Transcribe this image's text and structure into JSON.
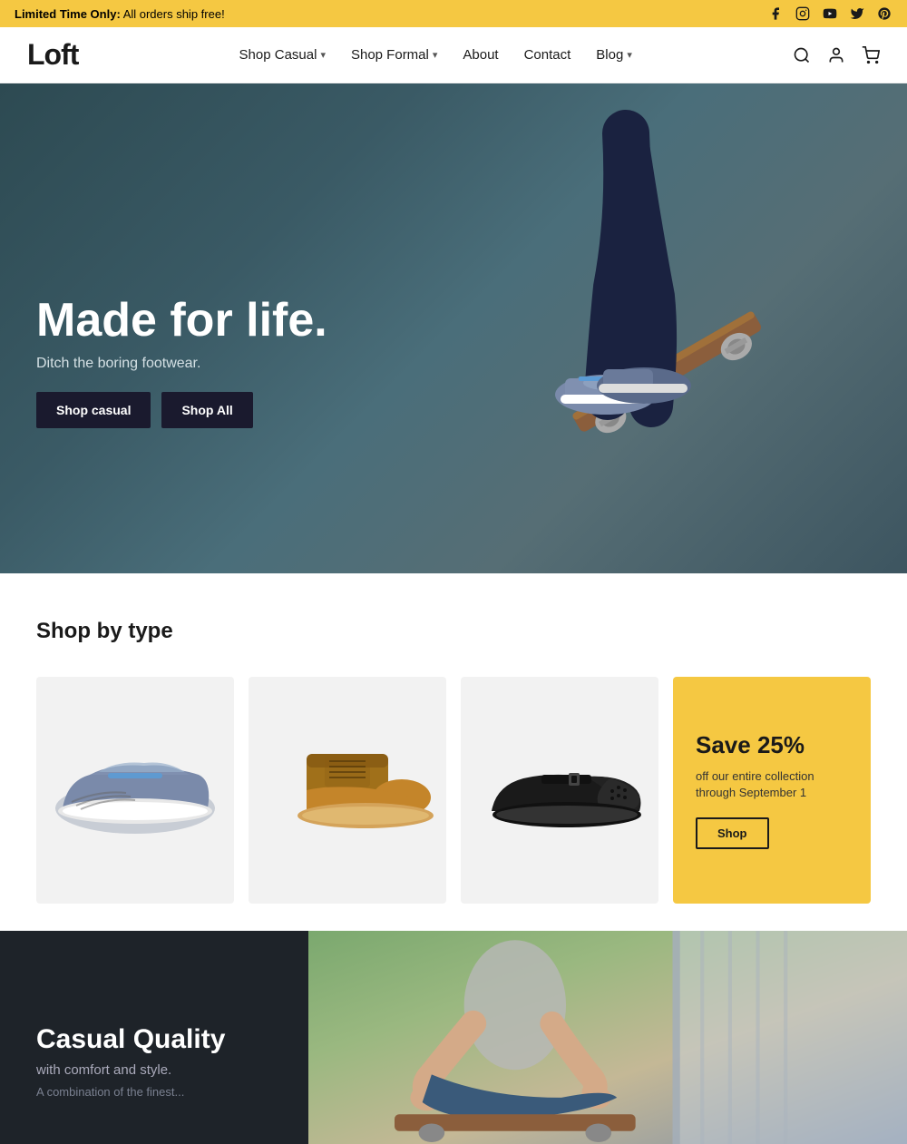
{
  "announcement": {
    "prefix": "Limited Time Only:",
    "message": " All orders ship free!"
  },
  "social_icons": [
    "facebook",
    "instagram",
    "youtube",
    "twitter",
    "pinterest"
  ],
  "logo": {
    "text": "Loft"
  },
  "nav": {
    "items": [
      {
        "label": "Shop Casual",
        "has_dropdown": true
      },
      {
        "label": "Shop Formal",
        "has_dropdown": true
      },
      {
        "label": "About",
        "has_dropdown": false
      },
      {
        "label": "Contact",
        "has_dropdown": false
      },
      {
        "label": "Blog",
        "has_dropdown": true
      }
    ]
  },
  "hero": {
    "title": "Made for life.",
    "subtitle": "Ditch the boring footwear.",
    "btn_casual": "Shop casual",
    "btn_all": "Shop All"
  },
  "shop_section": {
    "title": "Shop by type"
  },
  "products": [
    {
      "alt": "Gray casual sneaker"
    },
    {
      "alt": "Brown boot sneaker"
    },
    {
      "alt": "Black leather shoe"
    }
  ],
  "promo": {
    "title": "Save 25%",
    "text": "off our entire collection through September 1",
    "button": "Shop"
  },
  "bottom": {
    "title": "Casual Quality",
    "subtitle": "with comfort and style.",
    "description": "A combination of the finest..."
  }
}
